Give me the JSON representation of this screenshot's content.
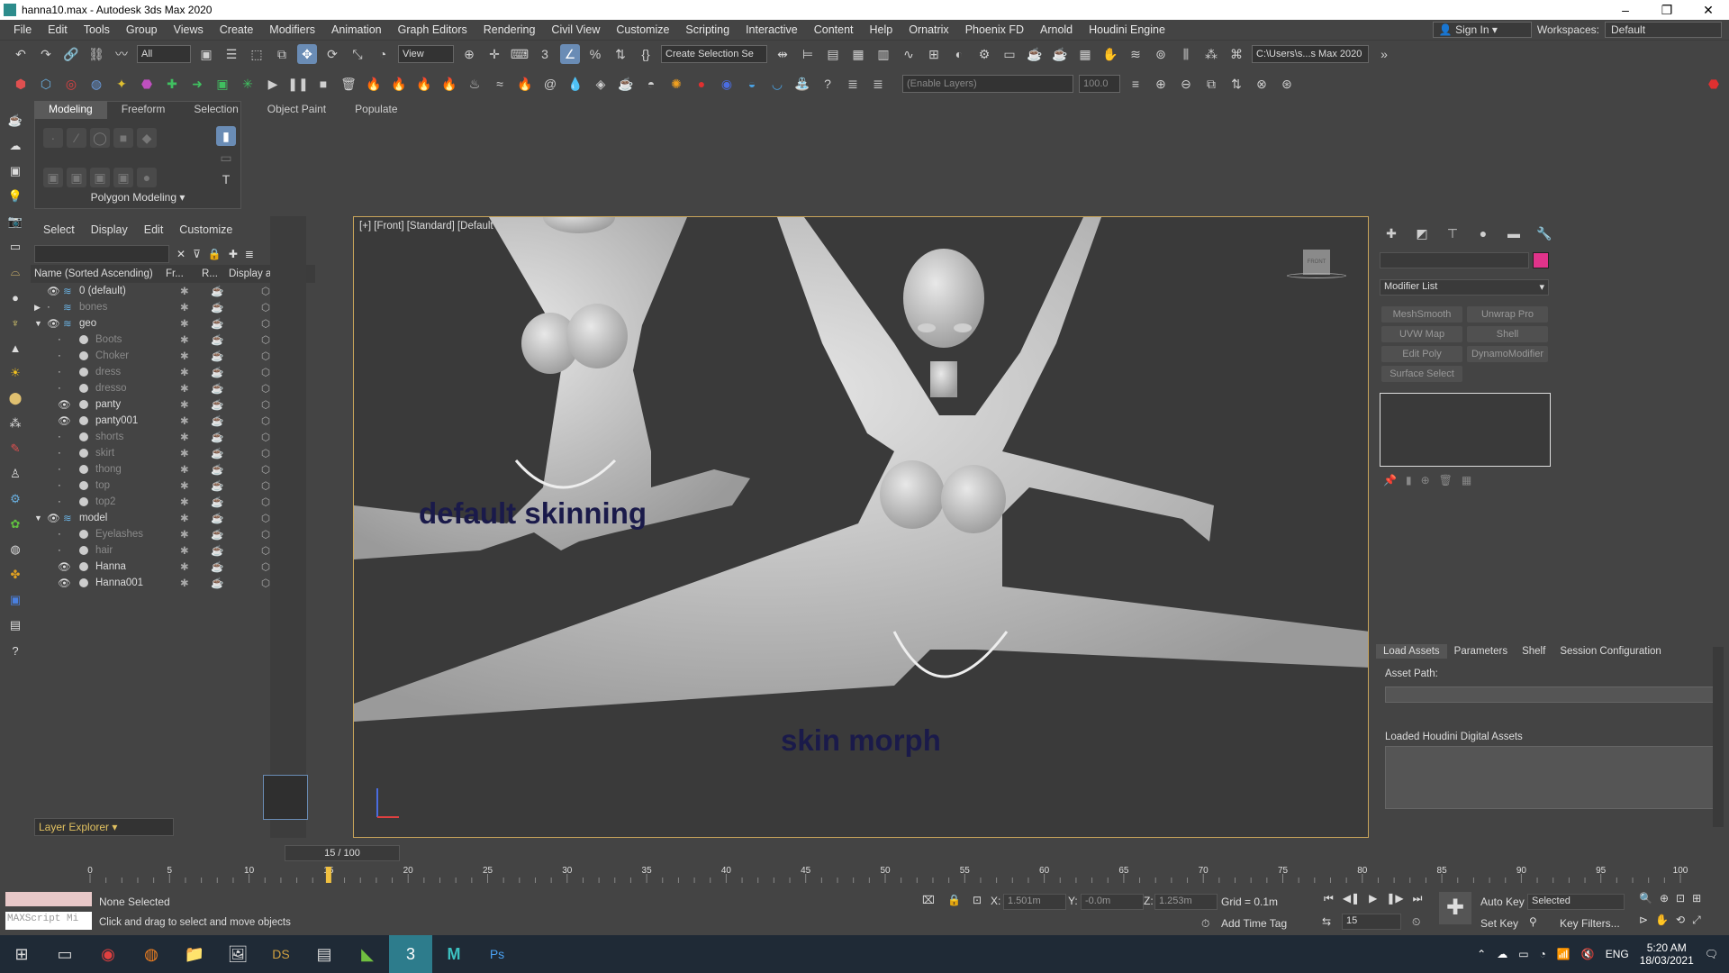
{
  "window": {
    "title": "hanna10.max - Autodesk 3ds Max 2020"
  },
  "menu": [
    "File",
    "Edit",
    "Tools",
    "Group",
    "Views",
    "Create",
    "Modifiers",
    "Animation",
    "Graph Editors",
    "Rendering",
    "Civil View",
    "Customize",
    "Scripting",
    "Interactive",
    "Content",
    "Help",
    "Ornatrix",
    "Phoenix FD",
    "Arnold",
    "Houdini Engine"
  ],
  "account": {
    "signin": "Sign In",
    "workspaces_label": "Workspaces:",
    "workspace": "Default"
  },
  "toolbar": {
    "filter": "All",
    "refcoord": "View",
    "selection_set": "Create Selection Se",
    "path": "C:\\Users\\s...s Max 2020",
    "layer_field": "(Enable Layers)",
    "percent": "100.0"
  },
  "ribbon": {
    "tabs": [
      "Modeling",
      "Freeform",
      "Selection",
      "Object Paint",
      "Populate"
    ],
    "footer": "Polygon Modeling"
  },
  "scene_explorer": {
    "menu": [
      "Select",
      "Display",
      "Edit",
      "Customize"
    ],
    "headers": {
      "name": "Name (Sorted Ascending)",
      "fr": "Fr...",
      "r": "R...",
      "box": "Display as Box"
    },
    "rows": [
      {
        "name": "0 (default)",
        "level": 0,
        "on": true
      },
      {
        "name": "bones",
        "level": 0,
        "on": false
      },
      {
        "name": "geo",
        "level": 0,
        "on": true
      },
      {
        "name": "Boots",
        "level": 1,
        "on": false
      },
      {
        "name": "Choker",
        "level": 1,
        "on": false
      },
      {
        "name": "dress",
        "level": 1,
        "on": false
      },
      {
        "name": "dresso",
        "level": 1,
        "on": false
      },
      {
        "name": "panty",
        "level": 1,
        "on": true
      },
      {
        "name": "panty001",
        "level": 1,
        "on": true
      },
      {
        "name": "shorts",
        "level": 1,
        "on": false
      },
      {
        "name": "skirt",
        "level": 1,
        "on": false
      },
      {
        "name": "thong",
        "level": 1,
        "on": false
      },
      {
        "name": "top",
        "level": 1,
        "on": false
      },
      {
        "name": "top2",
        "level": 1,
        "on": false
      },
      {
        "name": "model",
        "level": 0,
        "on": true
      },
      {
        "name": "Eyelashes",
        "level": 1,
        "on": false
      },
      {
        "name": "hair",
        "level": 1,
        "on": false
      },
      {
        "name": "Hanna",
        "level": 1,
        "on": true
      },
      {
        "name": "Hanna001",
        "level": 1,
        "on": true
      }
    ],
    "layer_explorer": "Layer Explorer"
  },
  "viewport": {
    "label": "[+] [Front] [Standard] [Default Shading]",
    "annotation_left": "default skinning",
    "annotation_right": "skin morph",
    "viewcube": "FRONT"
  },
  "command_panel": {
    "modifier_list": "Modifier List",
    "buttons": [
      "MeshSmooth",
      "Unwrap Pro",
      "UVW Map",
      "Shell",
      "Edit Poly",
      "DynamoModifier",
      "Surface Select"
    ],
    "color_swatch": "#e0338a"
  },
  "houdini": {
    "tabs": [
      "Load Assets",
      "Parameters",
      "Shelf",
      "Session Configuration"
    ],
    "asset_path": "Asset Path:",
    "loaded": "Loaded Houdini Digital Assets"
  },
  "timeline": {
    "frame": "15 / 100",
    "ticks": [
      "0",
      "5",
      "10",
      "15",
      "20",
      "25",
      "30",
      "35",
      "40",
      "45",
      "50",
      "55",
      "60",
      "65",
      "70",
      "75",
      "80",
      "85",
      "90",
      "95",
      "100"
    ]
  },
  "status": {
    "maxscript": "MAXScript Mi",
    "selection": "None Selected",
    "prompt": "Click and drag to select and move objects",
    "x": "1.501m",
    "y": "-0.0m",
    "z": "1.253m",
    "grid": "Grid = 0.1m",
    "add_time_tag": "Add Time Tag",
    "auto_key": "Auto Key",
    "set_key": "Set Key",
    "key_mode": "Selected",
    "key_filters": "Key Filters...",
    "frame_field": "15"
  },
  "taskbar": {
    "lang": "ENG",
    "time": "5:20 AM",
    "date": "18/03/2021"
  }
}
